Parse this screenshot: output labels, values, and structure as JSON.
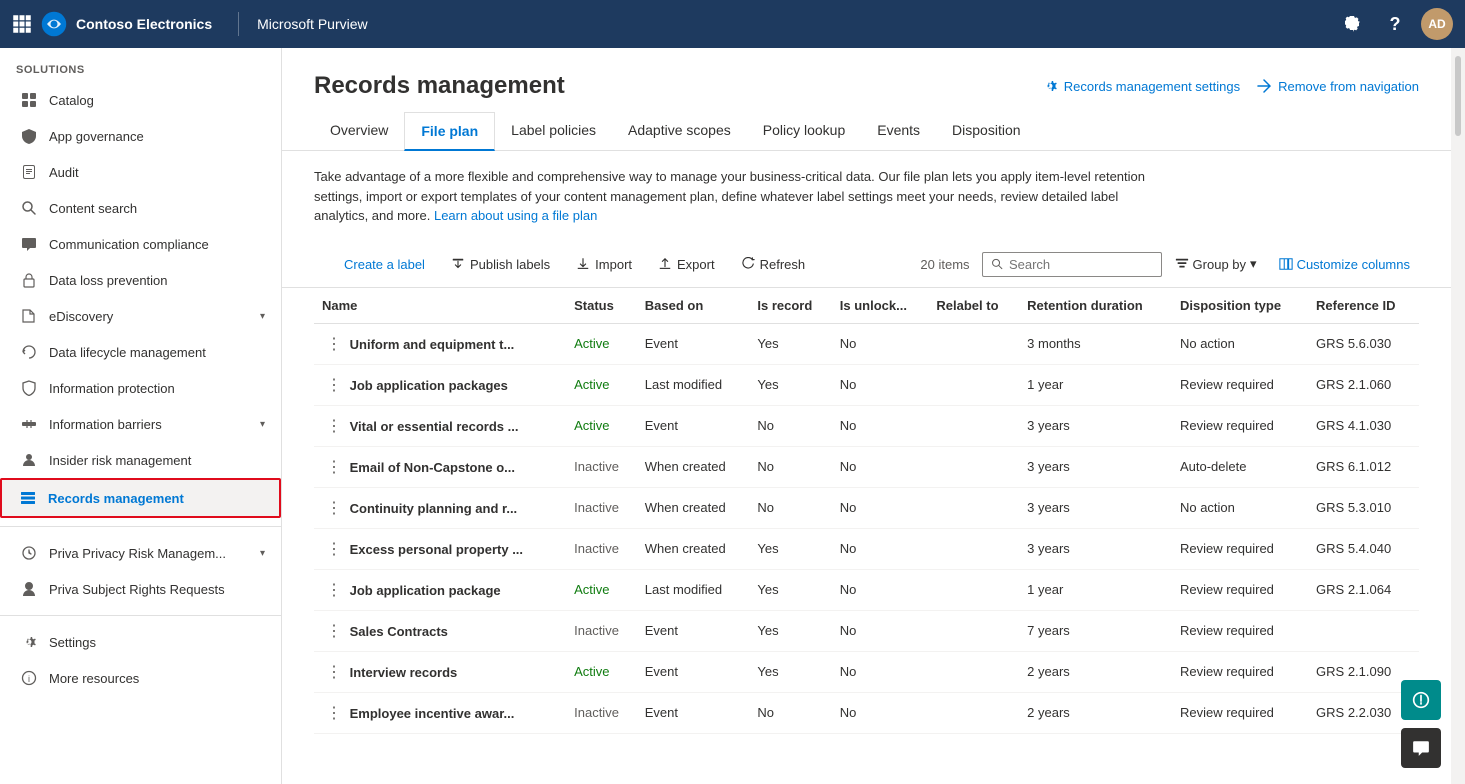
{
  "topNav": {
    "company": "Contoso Electronics",
    "product": "Microsoft Purview",
    "avatarInitials": "AD"
  },
  "sidebar": {
    "sectionLabel": "Solutions",
    "items": [
      {
        "id": "catalog",
        "label": "Catalog",
        "icon": "grid"
      },
      {
        "id": "app-governance",
        "label": "App governance",
        "icon": "shield"
      },
      {
        "id": "audit",
        "label": "Audit",
        "icon": "document"
      },
      {
        "id": "content-search",
        "label": "Content search",
        "icon": "search"
      },
      {
        "id": "communication-compliance",
        "label": "Communication compliance",
        "icon": "chat"
      },
      {
        "id": "data-loss-prevention",
        "label": "Data loss prevention",
        "icon": "lock"
      },
      {
        "id": "ediscovery",
        "label": "eDiscovery",
        "icon": "folder",
        "hasChevron": true
      },
      {
        "id": "data-lifecycle",
        "label": "Data lifecycle management",
        "icon": "recycle"
      },
      {
        "id": "information-protection",
        "label": "Information protection",
        "icon": "tag"
      },
      {
        "id": "information-barriers",
        "label": "Information barriers",
        "icon": "barrier",
        "hasChevron": true
      },
      {
        "id": "insider-risk",
        "label": "Insider risk management",
        "icon": "person"
      },
      {
        "id": "records-management",
        "label": "Records management",
        "icon": "records",
        "active": true
      }
    ],
    "bottomItems": [
      {
        "id": "priva-privacy",
        "label": "Priva Privacy Risk Managem...",
        "icon": "privacy",
        "hasChevron": true
      },
      {
        "id": "priva-subject",
        "label": "Priva Subject Rights Requests",
        "icon": "rights"
      }
    ],
    "footerItems": [
      {
        "id": "settings",
        "label": "Settings",
        "icon": "gear"
      },
      {
        "id": "more-resources",
        "label": "More resources",
        "icon": "info"
      }
    ]
  },
  "main": {
    "pageTitle": "Records management",
    "headerActions": [
      {
        "id": "settings",
        "label": "Records management settings"
      },
      {
        "id": "remove-nav",
        "label": "Remove from navigation"
      }
    ],
    "tabs": [
      {
        "id": "overview",
        "label": "Overview",
        "active": false
      },
      {
        "id": "file-plan",
        "label": "File plan",
        "active": true
      },
      {
        "id": "label-policies",
        "label": "Label policies",
        "active": false
      },
      {
        "id": "adaptive-scopes",
        "label": "Adaptive scopes",
        "active": false
      },
      {
        "id": "policy-lookup",
        "label": "Policy lookup",
        "active": false
      },
      {
        "id": "events",
        "label": "Events",
        "active": false
      },
      {
        "id": "disposition",
        "label": "Disposition",
        "active": false
      }
    ],
    "description": "Take advantage of a more flexible and comprehensive way to manage your business-critical data. Our file plan lets you apply item-level retention settings, import or export templates of your content management plan, define whatever label settings meet your needs, review detailed label analytics, and more.",
    "descriptionLink": "Learn about using a file plan",
    "toolbar": {
      "createLabel": "Create a label",
      "publishLabels": "Publish labels",
      "import": "Import",
      "export": "Export",
      "refresh": "Refresh",
      "itemCount": "20 items",
      "searchPlaceholder": "Search",
      "groupBy": "Group by",
      "customizeColumns": "Customize columns"
    },
    "tableColumns": [
      "Name",
      "Status",
      "Based on",
      "Is record",
      "Is unlock...",
      "Relabel to",
      "Retention duration",
      "Disposition type",
      "Reference ID"
    ],
    "tableRows": [
      {
        "name": "Uniform and equipment t...",
        "status": "Active",
        "basedOn": "Event",
        "isRecord": "Yes",
        "isUnlock": "No",
        "relabelTo": "",
        "retentionDuration": "3 months",
        "dispositionType": "No action",
        "referenceId": "GRS 5.6.030"
      },
      {
        "name": "Job application packages",
        "status": "Active",
        "basedOn": "Last modified",
        "isRecord": "Yes",
        "isUnlock": "No",
        "relabelTo": "",
        "retentionDuration": "1 year",
        "dispositionType": "Review required",
        "referenceId": "GRS 2.1.060"
      },
      {
        "name": "Vital or essential records ...",
        "status": "Active",
        "basedOn": "Event",
        "isRecord": "No",
        "isUnlock": "No",
        "relabelTo": "",
        "retentionDuration": "3 years",
        "dispositionType": "Review required",
        "referenceId": "GRS 4.1.030"
      },
      {
        "name": "Email of Non-Capstone o...",
        "status": "Inactive",
        "basedOn": "When created",
        "isRecord": "No",
        "isUnlock": "No",
        "relabelTo": "",
        "retentionDuration": "3 years",
        "dispositionType": "Auto-delete",
        "referenceId": "GRS 6.1.012"
      },
      {
        "name": "Continuity planning and r...",
        "status": "Inactive",
        "basedOn": "When created",
        "isRecord": "No",
        "isUnlock": "No",
        "relabelTo": "",
        "retentionDuration": "3 years",
        "dispositionType": "No action",
        "referenceId": "GRS 5.3.010"
      },
      {
        "name": "Excess personal property ...",
        "status": "Inactive",
        "basedOn": "When created",
        "isRecord": "Yes",
        "isUnlock": "No",
        "relabelTo": "",
        "retentionDuration": "3 years",
        "dispositionType": "Review required",
        "referenceId": "GRS 5.4.040"
      },
      {
        "name": "Job application package",
        "status": "Active",
        "basedOn": "Last modified",
        "isRecord": "Yes",
        "isUnlock": "No",
        "relabelTo": "",
        "retentionDuration": "1 year",
        "dispositionType": "Review required",
        "referenceId": "GRS 2.1.064"
      },
      {
        "name": "Sales Contracts",
        "status": "Inactive",
        "basedOn": "Event",
        "isRecord": "Yes",
        "isUnlock": "No",
        "relabelTo": "",
        "retentionDuration": "7 years",
        "dispositionType": "Review required",
        "referenceId": ""
      },
      {
        "name": "Interview records",
        "status": "Active",
        "basedOn": "Event",
        "isRecord": "Yes",
        "isUnlock": "No",
        "relabelTo": "",
        "retentionDuration": "2 years",
        "dispositionType": "Review required",
        "referenceId": "GRS 2.1.090"
      },
      {
        "name": "Employee incentive awar...",
        "status": "Inactive",
        "basedOn": "Event",
        "isRecord": "No",
        "isUnlock": "No",
        "relabelTo": "",
        "retentionDuration": "2 years",
        "dispositionType": "Review required",
        "referenceId": "GRS 2.2.030"
      }
    ]
  }
}
